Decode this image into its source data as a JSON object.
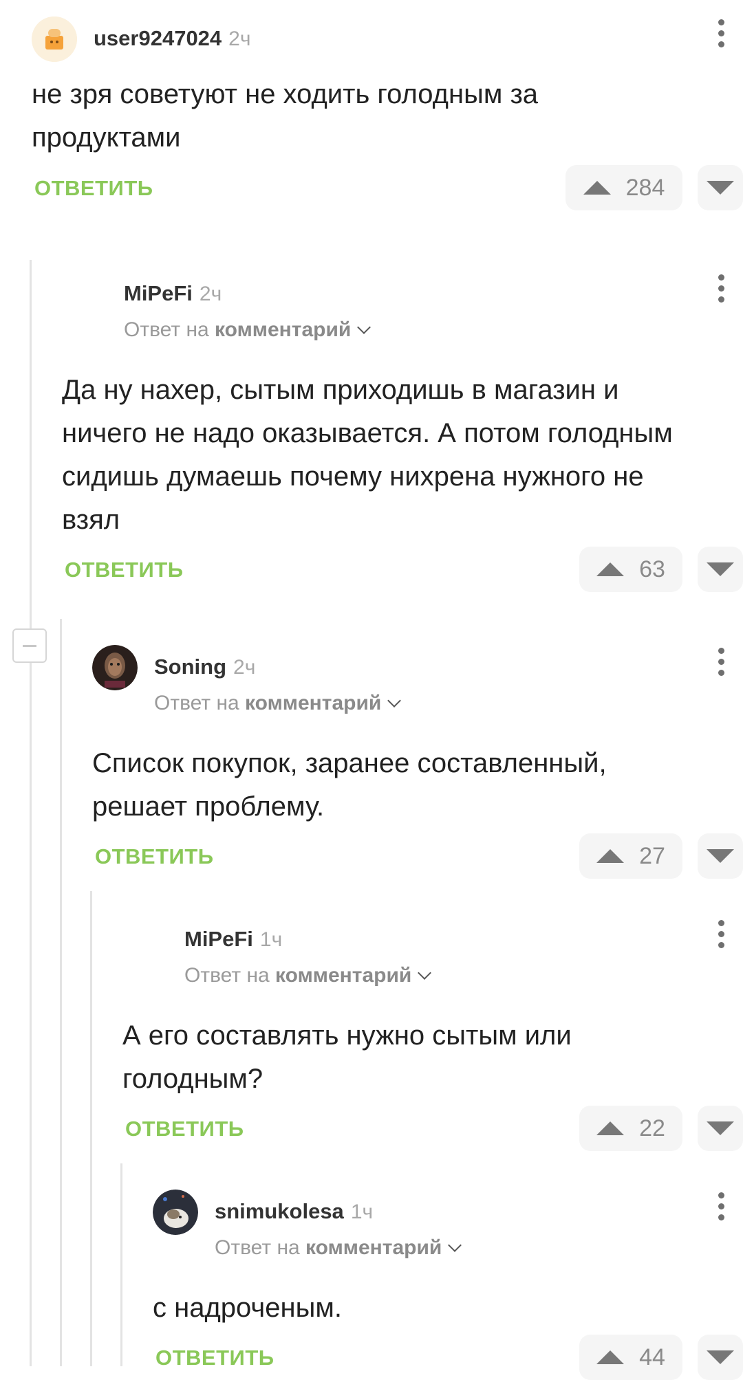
{
  "labels": {
    "reply_button": "ОТВЕТИТЬ",
    "reply_prefix": "Ответ на",
    "reply_target": "комментарий"
  },
  "comments": [
    {
      "author": "user9247024",
      "time": "2ч",
      "text": "не зря советуют не ходить голодным за продуктами",
      "rating": "284"
    },
    {
      "author": "MiPeFi",
      "time": "2ч",
      "text": "Да ну нахер, сытым приходишь в магазин и ничего не надо оказывается. А потом голодным сидишь думаешь почему нихрена нужного не взял",
      "rating": "63"
    },
    {
      "author": "Soning",
      "time": "2ч",
      "text": "Список покупок, заранее составленный, решает проблему.",
      "rating": "27"
    },
    {
      "author": "MiPeFi",
      "time": "1ч",
      "text": "А его составлять нужно сытым или голодным?",
      "rating": "22"
    },
    {
      "author": "snimukolesa",
      "time": "1ч",
      "text": "с надроченым.",
      "rating": "44"
    }
  ],
  "colors": {
    "accent_green": "#8ac858",
    "thread_line": "#e3e3e3",
    "vote_bg": "#f5f5f5"
  },
  "icons": [
    "more-vert-icon",
    "upvote-icon",
    "downvote-icon",
    "chevron-down-icon",
    "collapse-thread-icon"
  ]
}
